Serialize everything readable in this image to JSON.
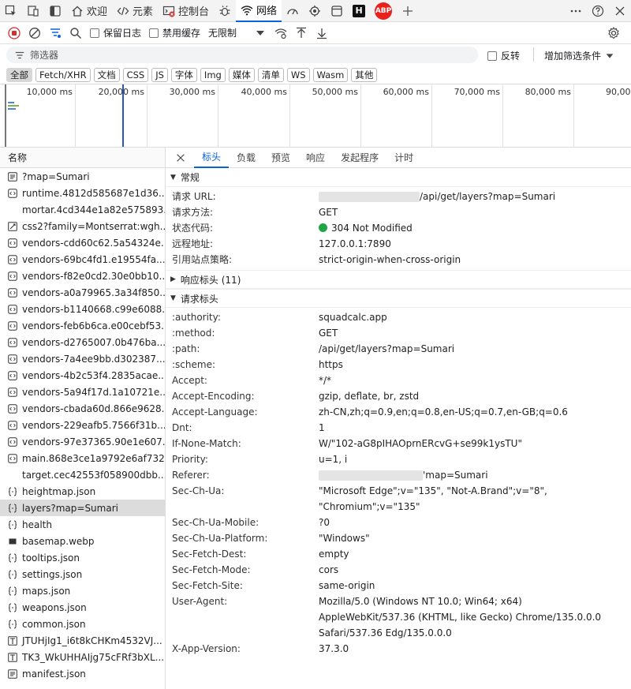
{
  "tabbar": {
    "tabs": [
      {
        "label": "欢迎"
      },
      {
        "label": "元素"
      },
      {
        "label": "控制台"
      },
      {
        "label": "网络"
      }
    ],
    "abp": "ABP",
    "h": "H"
  },
  "toolbar": {
    "preserve_log": "保留日志",
    "disable_cache": "禁用缓存",
    "throttle": "无限制"
  },
  "filter": {
    "placeholder": "筛选器",
    "invert": "反转",
    "more_filters": "增加筛选条件"
  },
  "types": [
    "全部",
    "Fetch/XHR",
    "文档",
    "CSS",
    "JS",
    "字体",
    "Img",
    "媒体",
    "清单",
    "WS",
    "Wasm",
    "其他"
  ],
  "timeline": {
    "ticks": [
      "10,000 ms",
      "20,000 ms",
      "30,000 ms",
      "40,000 ms",
      "50,000 ms",
      "60,000 ms",
      "70,000 ms",
      "80,000 ms",
      "90,00"
    ]
  },
  "list": {
    "header": "名称",
    "items": [
      {
        "name": "?map=Sumari",
        "icon": "doc-icon"
      },
      {
        "name": "runtime.4812d585687e1d36...",
        "icon": "script-icon"
      },
      {
        "name": "mortar.4cd344e1a82e575893...",
        "icon": "none"
      },
      {
        "name": "css2?family=Montserrat:wgh...",
        "icon": "css-icon"
      },
      {
        "name": "vendors-cdd60c62.5a54324e...",
        "icon": "script-icon"
      },
      {
        "name": "vendors-69bc4fd1.e19554fa...",
        "icon": "script-icon"
      },
      {
        "name": "vendors-f82e0cd2.30e0bb10...",
        "icon": "script-icon"
      },
      {
        "name": "vendors-a0a79965.3a34f850...",
        "icon": "script-icon"
      },
      {
        "name": "vendors-b1140668.c99e6088...",
        "icon": "script-icon"
      },
      {
        "name": "vendors-feb6b6ca.e00cebf53...",
        "icon": "script-icon"
      },
      {
        "name": "vendors-d2765007.0b476ba...",
        "icon": "script-icon"
      },
      {
        "name": "vendors-7a4ee9bb.d302387...",
        "icon": "script-icon"
      },
      {
        "name": "vendors-4b2c53f4.2835acae...",
        "icon": "script-icon"
      },
      {
        "name": "vendors-5a94f17d.1a10721e...",
        "icon": "script-icon"
      },
      {
        "name": "vendors-cbada60d.866e9628...",
        "icon": "script-icon"
      },
      {
        "name": "vendors-229eafb5.7566f31b...",
        "icon": "script-icon"
      },
      {
        "name": "vendors-97e37365.90e1e607...",
        "icon": "script-icon"
      },
      {
        "name": "main.868e3ce1a9792e6af732...",
        "icon": "script-icon"
      },
      {
        "name": "target.cec42553f058900dbb...",
        "icon": "none"
      },
      {
        "name": "heightmap.json",
        "icon": "json-icon"
      },
      {
        "name": "layers?map=Sumari",
        "icon": "json-icon"
      },
      {
        "name": "health",
        "icon": "json-icon"
      },
      {
        "name": "basemap.webp",
        "icon": "image-icon"
      },
      {
        "name": "tooltips.json",
        "icon": "json-icon"
      },
      {
        "name": "settings.json",
        "icon": "json-icon"
      },
      {
        "name": "maps.json",
        "icon": "json-icon"
      },
      {
        "name": "weapons.json",
        "icon": "json-icon"
      },
      {
        "name": "common.json",
        "icon": "json-icon"
      },
      {
        "name": "JTUHjIg1_i6t8kCHKm4532VJ...",
        "icon": "font-icon"
      },
      {
        "name": "TK3_WkUHHAIjg75cFRf3bXL...",
        "icon": "font-icon"
      },
      {
        "name": "manifest.json",
        "icon": "doc-icon"
      }
    ],
    "selected": 20
  },
  "detail": {
    "tabs": [
      "标头",
      "负载",
      "预览",
      "响应",
      "发起程序",
      "计时"
    ],
    "general": {
      "title": "常规",
      "rows": [
        {
          "k": "请求 URL:",
          "v": "/api/get/layers?map=Sumari"
        },
        {
          "k": "请求方法:",
          "v": "GET"
        },
        {
          "k": "状态代码:",
          "v": "304 Not Modified"
        },
        {
          "k": "远程地址:",
          "v": "127.0.0.1:7890"
        },
        {
          "k": "引用站点策略:",
          "v": "strict-origin-when-cross-origin"
        }
      ]
    },
    "response_headers": {
      "title": "响应标头 (11)"
    },
    "request_headers": {
      "title": "请求标头",
      "rows": [
        {
          "k": ":authority:",
          "v": "squadcalc.app"
        },
        {
          "k": ":method:",
          "v": "GET"
        },
        {
          "k": ":path:",
          "v": "/api/get/layers?map=Sumari"
        },
        {
          "k": ":scheme:",
          "v": "https"
        },
        {
          "k": "Accept:",
          "v": "*/*"
        },
        {
          "k": "Accept-Encoding:",
          "v": "gzip, deflate, br, zstd"
        },
        {
          "k": "Accept-Language:",
          "v": "zh-CN,zh;q=0.9,en;q=0.8,en-US;q=0.7,en-GB;q=0.6"
        },
        {
          "k": "Dnt:",
          "v": "1"
        },
        {
          "k": "If-None-Match:",
          "v": "W/\"102-aG8pIHAOprnERcvG+se99k1ysTU\""
        },
        {
          "k": "Priority:",
          "v": "u=1, i"
        },
        {
          "k": "Referer:",
          "v": "'map=Sumari"
        },
        {
          "k": "Sec-Ch-Ua:",
          "v": "\"Microsoft Edge\";v=\"135\", \"Not-A.Brand\";v=\"8\", \"Chromium\";v=\"135\""
        },
        {
          "k": "Sec-Ch-Ua-Mobile:",
          "v": "?0"
        },
        {
          "k": "Sec-Ch-Ua-Platform:",
          "v": "\"Windows\""
        },
        {
          "k": "Sec-Fetch-Dest:",
          "v": "empty"
        },
        {
          "k": "Sec-Fetch-Mode:",
          "v": "cors"
        },
        {
          "k": "Sec-Fetch-Site:",
          "v": "same-origin"
        },
        {
          "k": "User-Agent:",
          "v": "Mozilla/5.0 (Windows NT 10.0; Win64; x64) AppleWebKit/537.36 (KHTML, like Gecko) Chrome/135.0.0.0 Safari/537.36 Edg/135.0.0.0"
        },
        {
          "k": "X-App-Version:",
          "v": "37.3.0"
        }
      ]
    }
  }
}
